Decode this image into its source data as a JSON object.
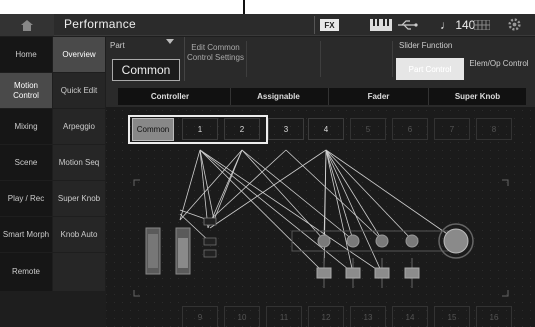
{
  "header": {
    "title": "Performance",
    "fx_label": "FX",
    "tempo": "♩ 140"
  },
  "nav": {
    "items": [
      {
        "label": "Home"
      },
      {
        "label": "Overview"
      },
      {
        "label": "Motion Control"
      },
      {
        "label": "Quick Edit"
      },
      {
        "label": "Mixing"
      },
      {
        "label": "Arpeggio"
      },
      {
        "label": "Scene"
      },
      {
        "label": "Motion Seq"
      },
      {
        "label": "Play / Rec"
      },
      {
        "label": "Super Knob"
      },
      {
        "label": "Smart Morph"
      },
      {
        "label": "Knob Auto"
      },
      {
        "label": "Remote"
      }
    ]
  },
  "tools": {
    "part_label": "Part",
    "part_value": "Common",
    "edit_common": "Edit Common Control Settings",
    "slider_function_label": "Slider Function",
    "part_control": "Part Control",
    "elem_op_control": "Elem/Op Control"
  },
  "tabs": [
    "Controller",
    "Assignable",
    "Fader",
    "Super Knob"
  ],
  "parts_top": [
    "Common",
    "1",
    "2",
    "3",
    "4",
    "5",
    "6",
    "7",
    "8"
  ],
  "parts_bottom": [
    "9",
    "10",
    "11",
    "12",
    "13",
    "14",
    "15",
    "16"
  ]
}
